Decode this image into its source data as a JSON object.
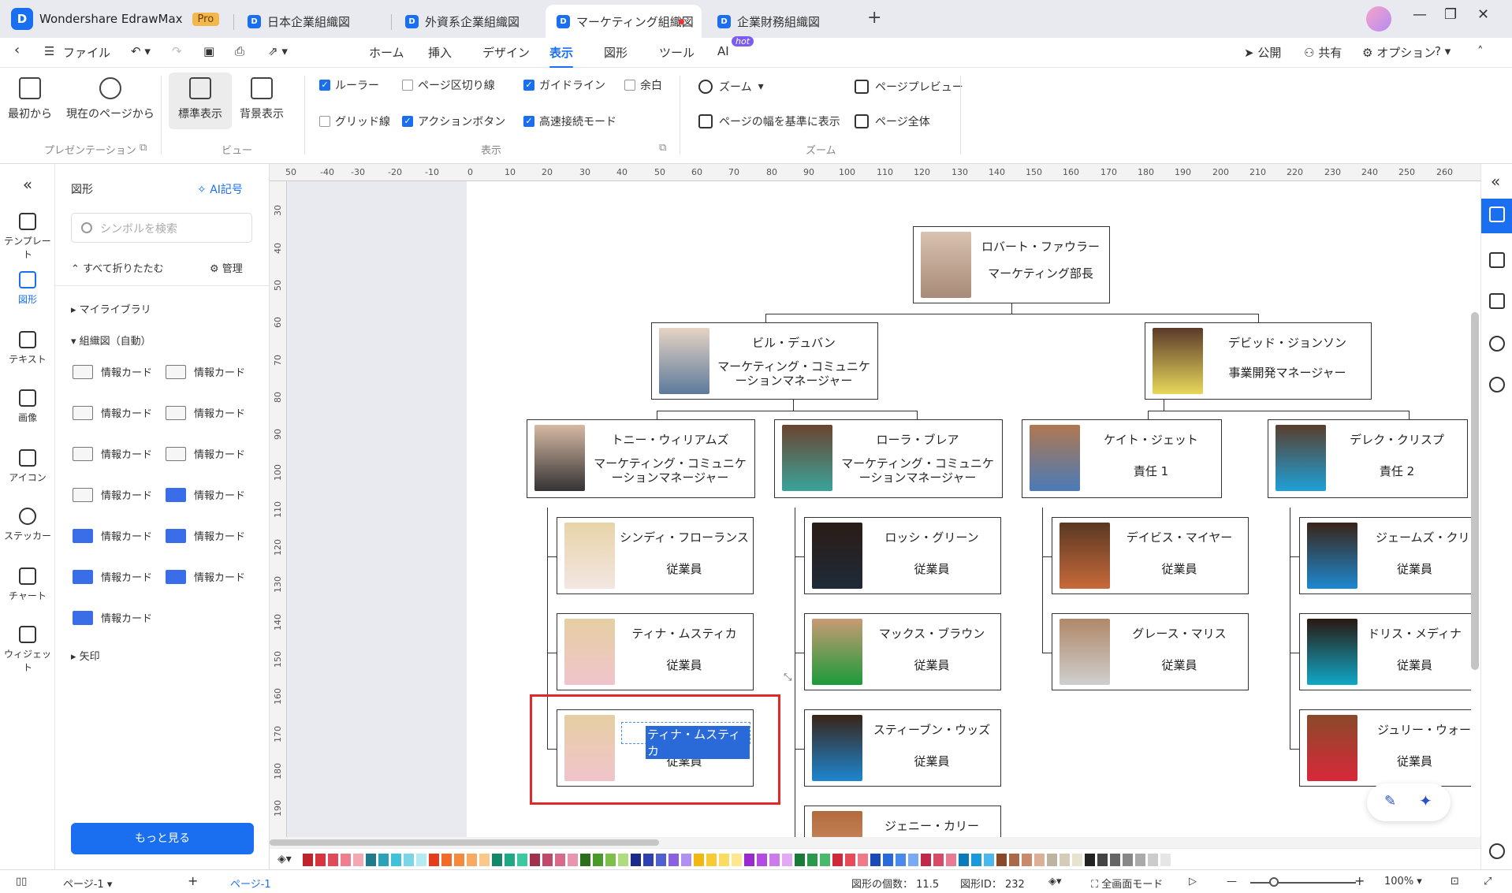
{
  "app": {
    "name": "Wondershare EdrawMax",
    "badge": "Pro"
  },
  "tabs": [
    {
      "label": "日本企業組織図",
      "active": false
    },
    {
      "label": "外資系企業組織図",
      "active": false
    },
    {
      "label": "マーケティング組織図",
      "active": true,
      "unsaved": true
    },
    {
      "label": "企業財務組織図",
      "active": false
    }
  ],
  "menu": {
    "file": "ファイル",
    "items": [
      "ホーム",
      "挿入",
      "デザイン",
      "表示",
      "図形",
      "ツール",
      "AI"
    ],
    "active": "表示",
    "ai_badge": "hot",
    "right": {
      "publish": "公開",
      "share": "共有",
      "options": "オプション"
    }
  },
  "ribbon": {
    "presentation": {
      "from_start": "最初から",
      "from_current": "現在のページから",
      "group": "プレゼンテーション"
    },
    "view": {
      "normal": "標準表示",
      "background": "背景表示",
      "group": "ビュー"
    },
    "display": {
      "ruler": {
        "label": "ルーラー",
        "checked": true
      },
      "page_break": {
        "label": "ページ区切り線",
        "checked": false
      },
      "guideline": {
        "label": "ガイドライン",
        "checked": true
      },
      "margin": {
        "label": "余白",
        "checked": false
      },
      "grid": {
        "label": "グリッド線",
        "checked": false
      },
      "action_button": {
        "label": "アクションボタン",
        "checked": true
      },
      "fast_connect": {
        "label": "高速接続モード",
        "checked": true
      },
      "group": "表示"
    },
    "zoom": {
      "zoom": "ズーム",
      "fit_width": "ページの幅を基準に表示",
      "preview": "ページプレビュー",
      "whole": "ページ全体",
      "group": "ズーム"
    }
  },
  "left_rail": [
    "テンプレート",
    "図形",
    "テキスト",
    "画像",
    "アイコン",
    "ステッカー",
    "チャート",
    "ウィジェット"
  ],
  "left_rail_active": "図形",
  "shapes_panel": {
    "title": "図形",
    "ai_symbol": "AI記号",
    "search_placeholder": "シンボルを検索",
    "collapse_all": "すべて折りたたむ",
    "manage": "管理",
    "my_library": "マイライブラリ",
    "org_chart": "組織図（自動）",
    "card_label": "情報カード",
    "arrows": "矢印",
    "more": "もっと見る"
  },
  "ruler": {
    "h": [
      "50",
      "-40",
      "-30",
      "-20",
      "-10",
      "0",
      "10",
      "20",
      "30",
      "40",
      "50",
      "60",
      "70",
      "80",
      "90",
      "100",
      "110",
      "120",
      "130",
      "140",
      "150",
      "160",
      "170",
      "180",
      "190",
      "200",
      "210",
      "220",
      "230",
      "240",
      "250",
      "260"
    ],
    "v": [
      "30",
      "40",
      "50",
      "60",
      "70",
      "80",
      "90",
      "100",
      "110",
      "120",
      "130",
      "140",
      "150",
      "160",
      "170",
      "180",
      "190"
    ]
  },
  "org": {
    "ceo": {
      "name": "ロバート・ファウラー",
      "title": "マーケティング部長"
    },
    "bill": {
      "name": "ビル・デュバン",
      "title": "マーケティング・コミュニケーションマネージャー"
    },
    "david": {
      "name": "デビッド・ジョンソン",
      "title": "事業開発マネージャー"
    },
    "tony": {
      "name": "トニー・ウィリアムズ",
      "title": "マーケティング・コミュニケーションマネージャー"
    },
    "laura": {
      "name": "ローラ・ブレア",
      "title": "マーケティング・コミュニケーションマネージャー"
    },
    "kate": {
      "name": "ケイト・ジェット",
      "title": "責任 1"
    },
    "derek": {
      "name": "デレク・クリスプ",
      "title": "責任 2"
    },
    "cindy": {
      "name": "シンディ・フローランス",
      "title": "従業員"
    },
    "tina1": {
      "name": "ティナ・ムスティカ",
      "title": "従業員"
    },
    "tina2": {
      "name": "ティナ・ムスティカ",
      "title": "従業員"
    },
    "rossi": {
      "name": "ロッシ・グリーン",
      "title": "従業員"
    },
    "max": {
      "name": "マックス・ブラウン",
      "title": "従業員"
    },
    "steven": {
      "name": "スティーブン・ウッズ",
      "title": "従業員"
    },
    "jenny": {
      "name": "ジェニー・カリー",
      "title": ""
    },
    "davis": {
      "name": "デイビス・マイヤー",
      "title": "従業員"
    },
    "grace": {
      "name": "グレース・マリス",
      "title": "従業員"
    },
    "james": {
      "name": "ジェームズ・クリステ",
      "title": "従業員"
    },
    "doris": {
      "name": "ドリス・メディナ",
      "title": "従業員"
    },
    "julie": {
      "name": "ジュリー・ウォーレン",
      "title": "従業員"
    }
  },
  "status": {
    "page_select": "ページ-1",
    "page_tab": "ページ-1",
    "shape_count_label": "図形の個数：",
    "shape_count": "11.5",
    "shape_id_label": "図形ID：",
    "shape_id": "232",
    "fullscreen": "全画面モード",
    "zoom": "100%"
  },
  "colors": {
    "accent": "#1a6ff0",
    "highlight": "#e02a2a"
  }
}
